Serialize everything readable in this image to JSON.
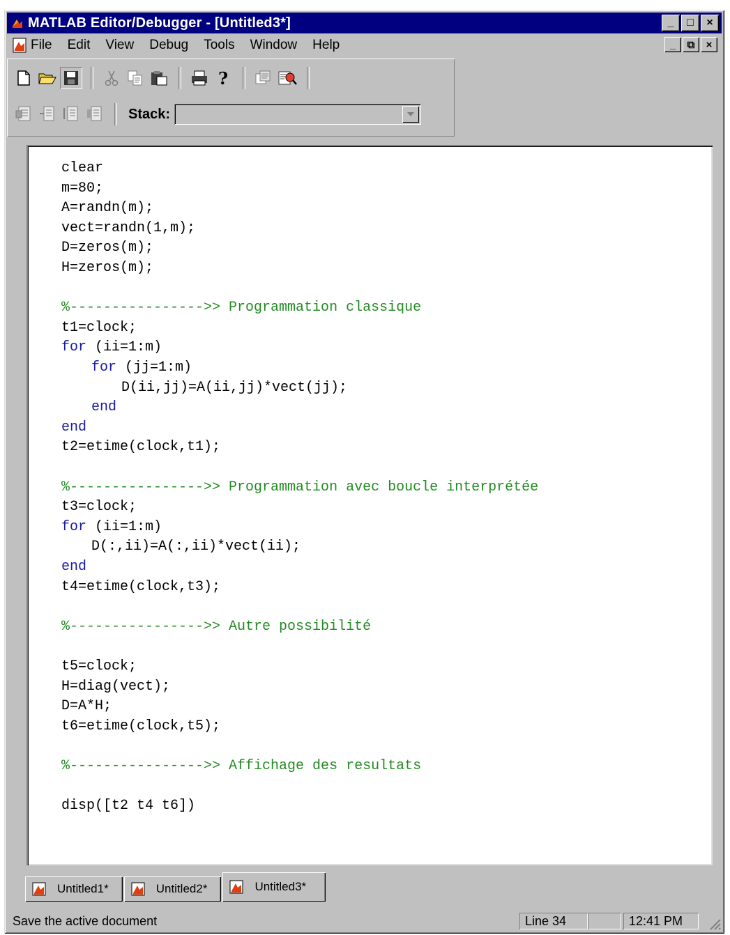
{
  "window": {
    "title": "MATLAB Editor/Debugger - [Untitled3*]"
  },
  "title_buttons": {
    "minimize": "_",
    "maximize": "□",
    "close": "×"
  },
  "mdi_buttons": {
    "minimize": "_",
    "restore": "⧉",
    "close": "×"
  },
  "menu": [
    {
      "label": "File"
    },
    {
      "label": "Edit"
    },
    {
      "label": "View"
    },
    {
      "label": "Debug"
    },
    {
      "label": "Tools"
    },
    {
      "label": "Window"
    },
    {
      "label": "Help"
    }
  ],
  "toolbar": {
    "buttons_row1": [
      "new-file-icon",
      "open-folder-icon",
      "save-icon",
      "cut-icon",
      "copy-icon",
      "paste-icon",
      "print-icon",
      "help-icon",
      "find-icon",
      "find-replace-icon"
    ],
    "buttons_row2": [
      "set-breakpoint-icon",
      "clear-breakpoint-icon",
      "step-in-icon",
      "step-out-icon"
    ],
    "stack_label": "Stack:",
    "stack_value": ""
  },
  "code_lines": [
    {
      "text": "clear",
      "type": "code",
      "indent": 0
    },
    {
      "text": "m=80;",
      "type": "code",
      "indent": 0
    },
    {
      "text": "A=randn(m);",
      "type": "code",
      "indent": 0
    },
    {
      "text": "vect=randn(1,m);",
      "type": "code",
      "indent": 0
    },
    {
      "text": "D=zeros(m);",
      "type": "code",
      "indent": 0
    },
    {
      "text": "H=zeros(m);",
      "type": "code",
      "indent": 0
    },
    {
      "text": "",
      "type": "blank",
      "indent": 0
    },
    {
      "text": "%---------------->> Programmation classique",
      "type": "comment",
      "indent": 0
    },
    {
      "text": "t1=clock;",
      "type": "code",
      "indent": 0
    },
    {
      "kw": "for",
      "text": " (ii=1:m)",
      "type": "keyword",
      "indent": 0
    },
    {
      "kw": "for",
      "text": " (jj=1:m)",
      "type": "keyword",
      "indent": 1
    },
    {
      "text": "D(ii,jj)=A(ii,jj)*vect(jj);",
      "type": "code",
      "indent": 2
    },
    {
      "kw": "end",
      "text": "",
      "type": "keyword",
      "indent": 1
    },
    {
      "kw": "end",
      "text": "",
      "type": "keyword",
      "indent": 0
    },
    {
      "text": "t2=etime(clock,t1);",
      "type": "code",
      "indent": 0
    },
    {
      "text": "",
      "type": "blank",
      "indent": 0
    },
    {
      "text": "%---------------->> Programmation avec boucle interprétée",
      "type": "comment",
      "indent": 0
    },
    {
      "text": "t3=clock;",
      "type": "code",
      "indent": 0
    },
    {
      "kw": "for",
      "text": " (ii=1:m)",
      "type": "keyword",
      "indent": 0
    },
    {
      "text": "D(:,ii)=A(:,ii)*vect(ii);",
      "type": "code",
      "indent": 1
    },
    {
      "kw": "end",
      "text": "",
      "type": "keyword",
      "indent": 0
    },
    {
      "text": "t4=etime(clock,t3);",
      "type": "code",
      "indent": 0
    },
    {
      "text": "",
      "type": "blank",
      "indent": 0
    },
    {
      "text": "%---------------->> Autre possibilité",
      "type": "comment",
      "indent": 0
    },
    {
      "text": "",
      "type": "blank",
      "indent": 0
    },
    {
      "text": "t5=clock;",
      "type": "code",
      "indent": 0
    },
    {
      "text": "H=diag(vect);",
      "type": "code",
      "indent": 0
    },
    {
      "text": "D=A*H;",
      "type": "code",
      "indent": 0
    },
    {
      "text": "t6=etime(clock,t5);",
      "type": "code",
      "indent": 0
    },
    {
      "text": "",
      "type": "blank",
      "indent": 0
    },
    {
      "text": "%---------------->> Affichage des resultats",
      "type": "comment",
      "indent": 0
    },
    {
      "text": "",
      "type": "blank",
      "indent": 0
    },
    {
      "text": "disp([t2 t4 t6])",
      "type": "code",
      "indent": 0
    }
  ],
  "tabs": [
    {
      "label": "Untitled1*",
      "active": false
    },
    {
      "label": "Untitled2*",
      "active": false
    },
    {
      "label": "Untitled3*",
      "active": true
    }
  ],
  "status": {
    "message": "Save the active document",
    "line": "Line 34",
    "time": "12:41 PM"
  },
  "colors": {
    "titlebar": "#000080",
    "keyword": "#1a1aa6",
    "comment": "#228b22",
    "chrome": "#c0c0c0"
  }
}
